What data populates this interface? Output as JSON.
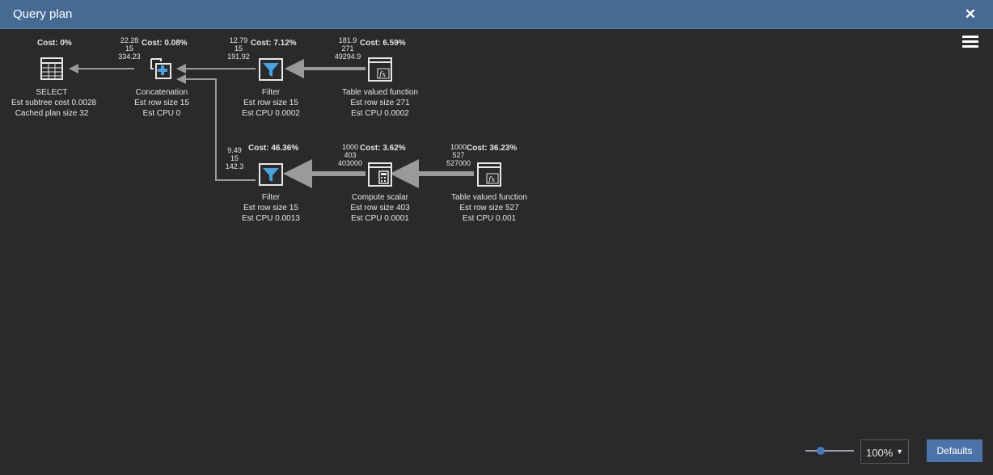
{
  "window": {
    "title": "Query plan",
    "close_glyph": "✕"
  },
  "icons": {
    "menu": "hamburger-menu-icon",
    "close": "close-icon"
  },
  "colors": {
    "titlebar": "#476a95",
    "accent": "#4c74a8",
    "filter_blue": "#4aa3df",
    "background": "#2a2a2d"
  },
  "nodes": {
    "select": {
      "cost": "Cost: 0%",
      "name": "SELECT",
      "line1": "Est subtree cost  0.0028",
      "line2": "Cached plan size  32"
    },
    "concat": {
      "cost": "Cost: 0.08%",
      "s1": "22.28",
      "s2": "15",
      "s3": "334.23",
      "name": "Concatenation",
      "line1": "Est row size  15",
      "line2": "Est CPU  0"
    },
    "filter1": {
      "cost": "Cost: 7.12%",
      "s1": "12.79",
      "s2": "15",
      "s3": "191.92",
      "name": "Filter",
      "line1": "Est row size  15",
      "line2": "Est CPU  0.0002"
    },
    "tvf1": {
      "cost": "Cost: 6.59%",
      "s1": "181.9",
      "s2": "271",
      "s3": "49294.9",
      "name": "Table valued function",
      "line1": "Est row size  271",
      "line2": "Est CPU  0.0002"
    },
    "filter2": {
      "cost": "Cost: 46.36%",
      "s1": "9.49",
      "s2": "15",
      "s3": "142.3",
      "name": "Filter",
      "line1": "Est row size  15",
      "line2": "Est CPU  0.0013"
    },
    "compute": {
      "cost": "Cost: 3.62%",
      "s1": "1000",
      "s2": "403",
      "s3": "403000",
      "name": "Compute scalar",
      "line1": "Est row size  403",
      "line2": "Est CPU  0.0001"
    },
    "tvf2": {
      "cost": "Cost: 36.23%",
      "s1": "1000",
      "s2": "527",
      "s3": "527000",
      "name": "Table valued function",
      "line1": "Est row size  527",
      "line2": "Est CPU  0.001"
    }
  },
  "footer": {
    "zoom_value": "100%",
    "zoom_arrow": "▼",
    "defaults_label": "Defaults",
    "zoom_level": 0.27
  }
}
